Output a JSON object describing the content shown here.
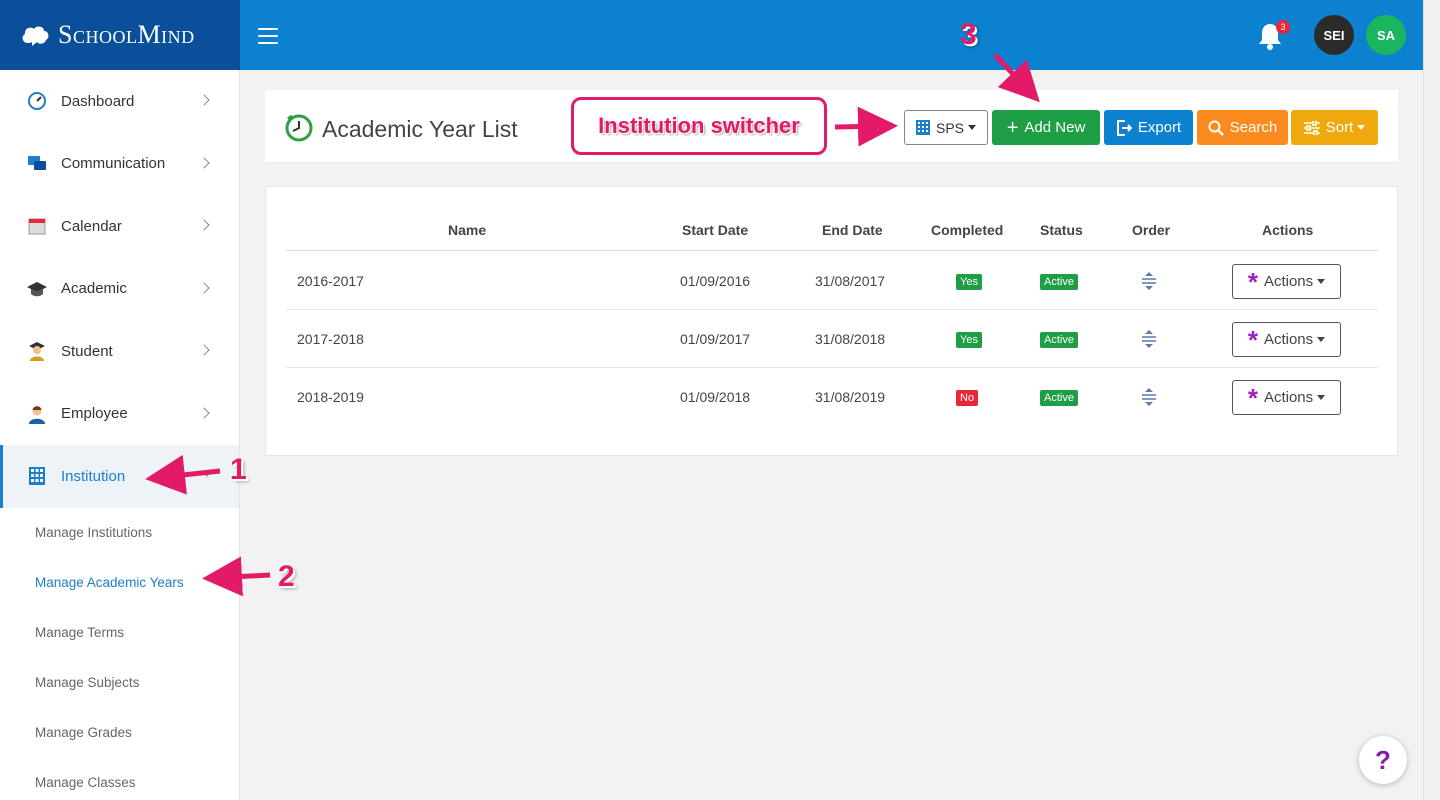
{
  "brand": {
    "name": "SchoolMind"
  },
  "topbar": {
    "notification_count": "3",
    "avatars": [
      "SEI",
      "SA"
    ]
  },
  "sidebar": {
    "items": [
      {
        "label": "Dashboard",
        "icon": "dashboard-gauge-icon"
      },
      {
        "label": "Communication",
        "icon": "chat-bubbles-icon"
      },
      {
        "label": "Calendar",
        "icon": "calendar-icon"
      },
      {
        "label": "Academic",
        "icon": "graduation-cap-icon"
      },
      {
        "label": "Student",
        "icon": "student-icon"
      },
      {
        "label": "Employee",
        "icon": "employee-icon"
      },
      {
        "label": "Institution",
        "icon": "building-icon"
      }
    ],
    "sub_items": [
      "Manage Institutions",
      "Manage Academic Years",
      "Manage Terms",
      "Manage Subjects",
      "Manage Grades",
      "Manage Classes"
    ]
  },
  "header": {
    "title": "Academic Year List",
    "institution_selector": "SPS",
    "add_new": "Add New",
    "export": "Export",
    "search": "Search",
    "sort": "Sort"
  },
  "table": {
    "columns": [
      "Name",
      "Start Date",
      "End Date",
      "Completed",
      "Status",
      "Order",
      "Actions"
    ],
    "rows": [
      {
        "name": "2016-2017",
        "start": "01/09/2016",
        "end": "31/08/2017",
        "completed": "Yes",
        "status": "Active",
        "actions": "Actions"
      },
      {
        "name": "2017-2018",
        "start": "01/09/2017",
        "end": "31/08/2018",
        "completed": "Yes",
        "status": "Active",
        "actions": "Actions"
      },
      {
        "name": "2018-2019",
        "start": "01/09/2018",
        "end": "31/08/2019",
        "completed": "No",
        "status": "Active",
        "actions": "Actions"
      }
    ]
  },
  "annotations": {
    "callout": "Institution switcher",
    "step1": "1",
    "step2": "2",
    "step3": "3"
  },
  "help": {
    "label": "?"
  },
  "colors": {
    "brand_dark": "#0a4f9a",
    "topbar": "#0c81cf",
    "green": "#1e9e45",
    "blue": "#0c81cf",
    "orange": "#fb8a1f",
    "amber": "#f0a80f",
    "red": "#e8283a",
    "annotation": "#e31a67"
  }
}
